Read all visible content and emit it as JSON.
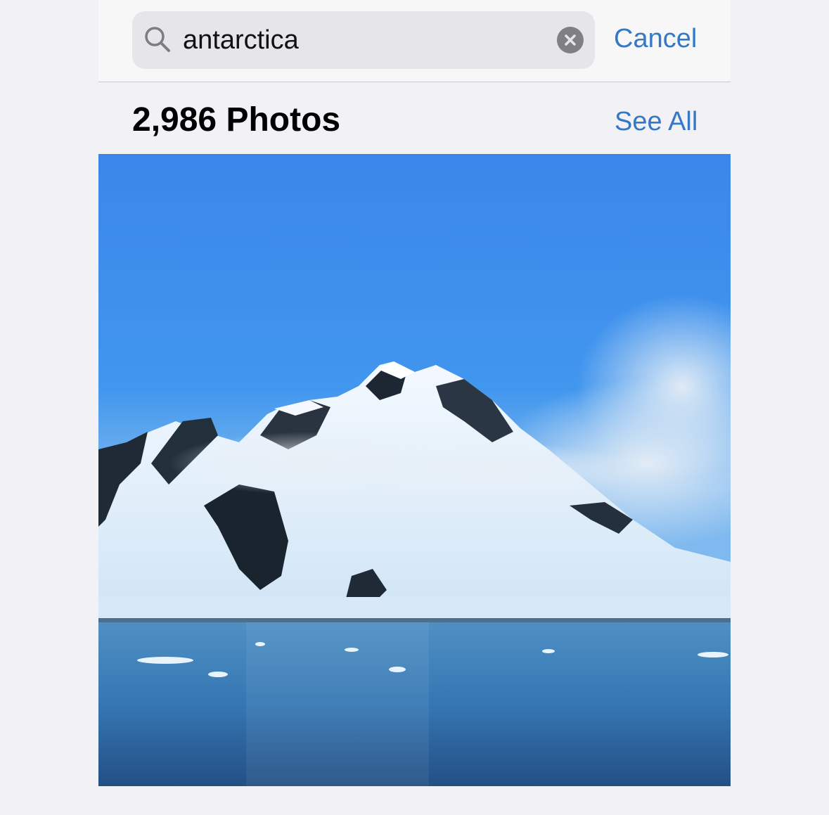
{
  "search": {
    "query": "antarctica",
    "cancel_label": "Cancel"
  },
  "results": {
    "photos_count_label": "2,986 Photos",
    "see_all_label": "See All"
  },
  "icons": {
    "search": "magnifying-glass-icon",
    "clear": "clear-circle-x-icon"
  },
  "colors": {
    "accent": "#3478c6",
    "background": "#f2f1f6",
    "search_field": "#e6e6ea"
  }
}
